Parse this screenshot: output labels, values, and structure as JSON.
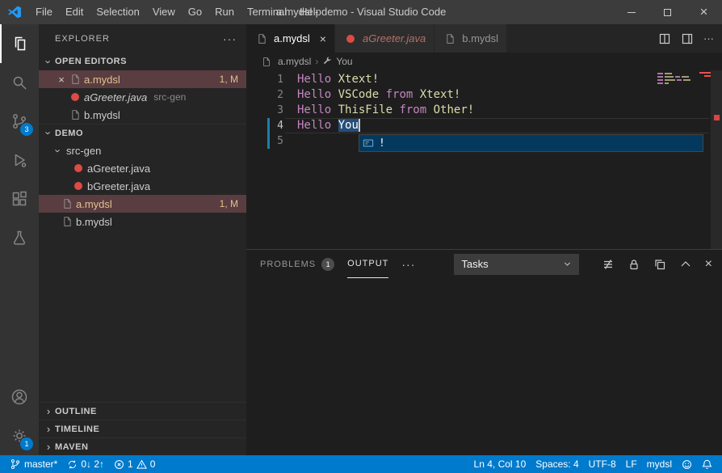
{
  "colors": {
    "accent": "#007ACC",
    "modified": "#E2C08D",
    "error": "#F14C4C",
    "keyword": "#C586C0",
    "identifier": "#DCDCAA"
  },
  "icons": {
    "more": "···",
    "chevron": "›",
    "close": "×"
  },
  "titlebar": {
    "menus": [
      "File",
      "Edit",
      "Selection",
      "View",
      "Go",
      "Run",
      "Terminal",
      "Help"
    ],
    "title": "a.mydsl - demo - Visual Studio Code"
  },
  "activitybar": {
    "scm_badge": "3",
    "manage_badge": "1"
  },
  "sidebar": {
    "header": "EXPLORER",
    "open_editors": {
      "label": "OPEN EDITORS",
      "items": [
        {
          "name": "a.mydsl",
          "badge": "1, M"
        },
        {
          "name": "aGreeter.java",
          "description": "src-gen"
        },
        {
          "name": "b.mydsl"
        }
      ]
    },
    "folder": {
      "label": "DEMO",
      "srcgen": "src-gen",
      "srcgen_files": [
        {
          "name": "aGreeter.java"
        },
        {
          "name": "bGreeter.java"
        }
      ],
      "files": [
        {
          "name": "a.mydsl",
          "badge": "1, M"
        },
        {
          "name": "b.mydsl"
        }
      ]
    },
    "bottom_sections": [
      {
        "label": "OUTLINE"
      },
      {
        "label": "TIMELINE"
      },
      {
        "label": "MAVEN"
      }
    ]
  },
  "editor": {
    "tabs": [
      {
        "label": "a.mydsl"
      },
      {
        "label": "aGreeter.java"
      },
      {
        "label": "b.mydsl"
      }
    ],
    "breadcrumbs": {
      "file": "a.mydsl",
      "symbol": "You"
    },
    "lines": [
      {
        "num": "1",
        "tokens": [
          {
            "text": "Hello"
          },
          {
            "text": " Xtext!"
          }
        ]
      },
      {
        "num": "2",
        "tokens": [
          {
            "text": "Hello"
          },
          {
            "text": " VSCode "
          },
          {
            "text": "from"
          },
          {
            "text": " Xtext!"
          }
        ]
      },
      {
        "num": "3",
        "tokens": [
          {
            "text": "Hello"
          },
          {
            "text": " ThisFile "
          },
          {
            "text": "from"
          },
          {
            "text": " Other!"
          }
        ]
      },
      {
        "num": "4",
        "tokens": [
          {
            "text": "Hello"
          },
          {
            "text": " "
          },
          {
            "text": "You"
          }
        ]
      },
      {
        "num": "5",
        "tokens": []
      }
    ],
    "suggest": {
      "label": "!"
    }
  },
  "panel": {
    "tabs": [
      {
        "label": "PROBLEMS",
        "badge": "1"
      },
      {
        "label": "OUTPUT"
      }
    ],
    "select_value": "Tasks"
  },
  "statusbar": {
    "branch": "master*",
    "sync": "0↓ 2↑",
    "errors": "1",
    "warnings": "0",
    "line_col": "Ln 4, Col 10",
    "indent": "Spaces: 4",
    "encoding": "UTF-8",
    "eol": "LF",
    "language": "mydsl"
  }
}
